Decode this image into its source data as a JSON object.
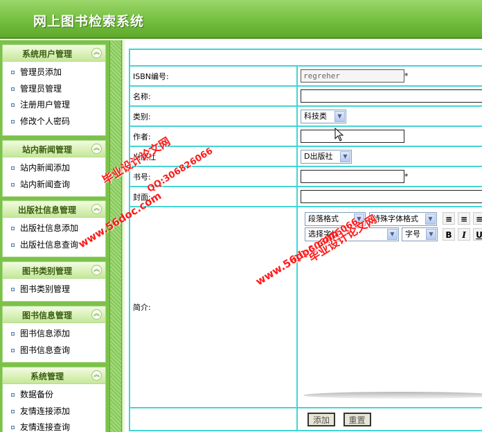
{
  "app": {
    "title": "网上图书检索系统"
  },
  "sidebar": {
    "panels": [
      {
        "title": "系统用户管理",
        "items": [
          "管理员添加",
          "管理员管理",
          "注册用户管理",
          "修改个人密码"
        ]
      },
      {
        "title": "站内新闻管理",
        "items": [
          "站内新闻添加",
          "站内新闻查询"
        ]
      },
      {
        "title": "出版社信息管理",
        "items": [
          "出版社信息添加",
          "出版社信息查询"
        ]
      },
      {
        "title": "图书类别管理",
        "items": [
          "图书类别管理"
        ]
      },
      {
        "title": "图书信息管理",
        "items": [
          "图书信息添加",
          "图书信息查询"
        ]
      },
      {
        "title": "系统管理",
        "items": [
          "数据备份",
          "友情连接添加",
          "友情连接查询"
        ]
      }
    ]
  },
  "form": {
    "fields": {
      "isbn": {
        "label": "ISBN编号:",
        "value": "regreher",
        "required": "*"
      },
      "name": {
        "label": "名称:"
      },
      "category": {
        "label": "类别:",
        "selected": "科技类"
      },
      "author": {
        "label": "作者:"
      },
      "publisher": {
        "label": "出版社",
        "selected": "D出版社"
      },
      "booknum": {
        "label": "书号:",
        "required": "*"
      },
      "cover": {
        "label": "封面:"
      },
      "intro": {
        "label": "简介:"
      }
    },
    "editor": {
      "paragraph_format": "段落格式",
      "special_format": "特殊字体格式",
      "font": "选择字体",
      "font_size": "字号",
      "bold": "B",
      "italic": "I",
      "underline": "U"
    },
    "buttons": {
      "add": "添加",
      "reset": "重置"
    }
  },
  "watermarks": {
    "site_cn": "毕业设计论文网",
    "site_url": "www.56doc.com",
    "qq": "QQ:306826066"
  }
}
